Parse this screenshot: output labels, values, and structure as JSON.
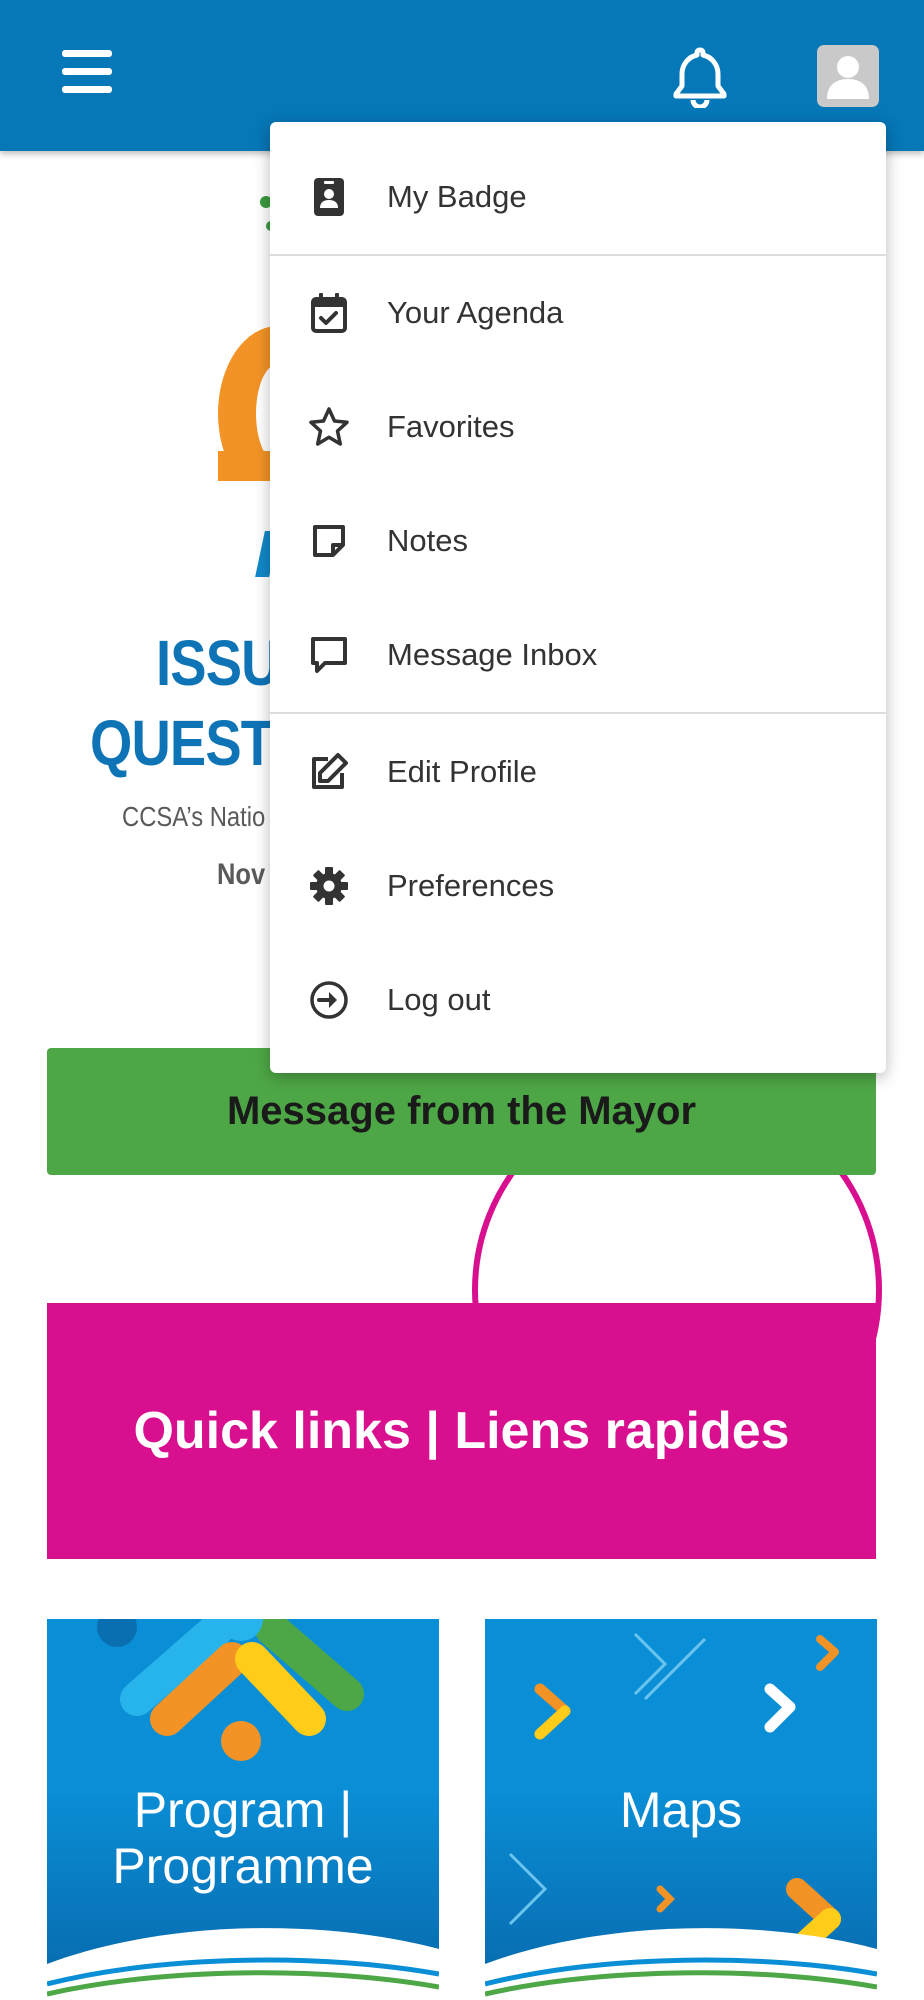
{
  "header": {
    "menu_icon": "hamburger-menu-icon",
    "notifications_icon": "bell-icon",
    "profile_icon": "user-avatar-icon",
    "background_color": "#0677b7"
  },
  "dropdown": {
    "items": [
      {
        "label": "My Badge",
        "icon": "badge-icon"
      },
      {
        "label": "Your Agenda",
        "icon": "calendar-check-icon"
      },
      {
        "label": "Favorites",
        "icon": "star-icon"
      },
      {
        "label": "Notes",
        "icon": "note-icon"
      },
      {
        "label": "Message Inbox",
        "icon": "message-icon"
      },
      {
        "label": "Edit Profile",
        "icon": "edit-icon"
      },
      {
        "label": "Preferences",
        "icon": "gear-icon"
      },
      {
        "label": "Log out",
        "icon": "logout-icon"
      }
    ]
  },
  "hero": {
    "line1": "ISSU",
    "line2": "QUEST",
    "subtitle": "CCSA’s Natio",
    "date": "Nov"
  },
  "mayor_button": {
    "label": "Message from the Mayor",
    "color": "#4ea746"
  },
  "quick_links": {
    "label": "Quick links | Liens rapides",
    "color": "#d80f8e"
  },
  "tiles": [
    {
      "label_line1": "Program |",
      "label_line2": "Programme"
    },
    {
      "label": "Maps"
    }
  ]
}
